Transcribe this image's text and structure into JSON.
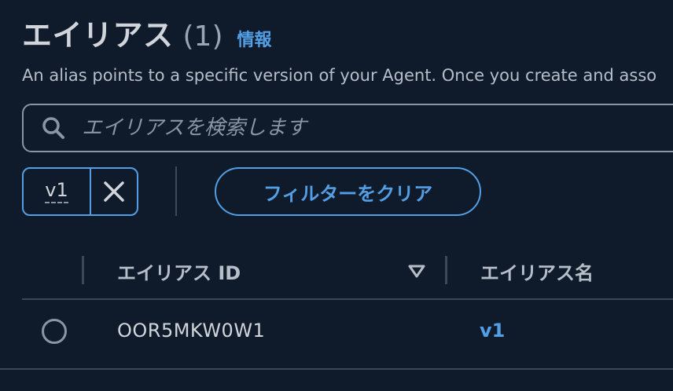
{
  "header": {
    "title": "エイリアス",
    "count": "(1)",
    "info_link": "情報"
  },
  "description": "An alias points to a specific version of your Agent. Once you create and asso",
  "search": {
    "placeholder": "エイリアスを検索します",
    "value": ""
  },
  "filter": {
    "token_label": "v1",
    "clear_label": "フィルターをクリア"
  },
  "table": {
    "columns": [
      "エイリアス ID",
      "エイリアス名"
    ],
    "rows": [
      {
        "id": "OOR5MKW0W1",
        "name": "v1"
      }
    ]
  },
  "colors": {
    "background": "#0f1b2a",
    "accent": "#539fe5",
    "border": "#3d4756",
    "text": "#d1d5db"
  }
}
